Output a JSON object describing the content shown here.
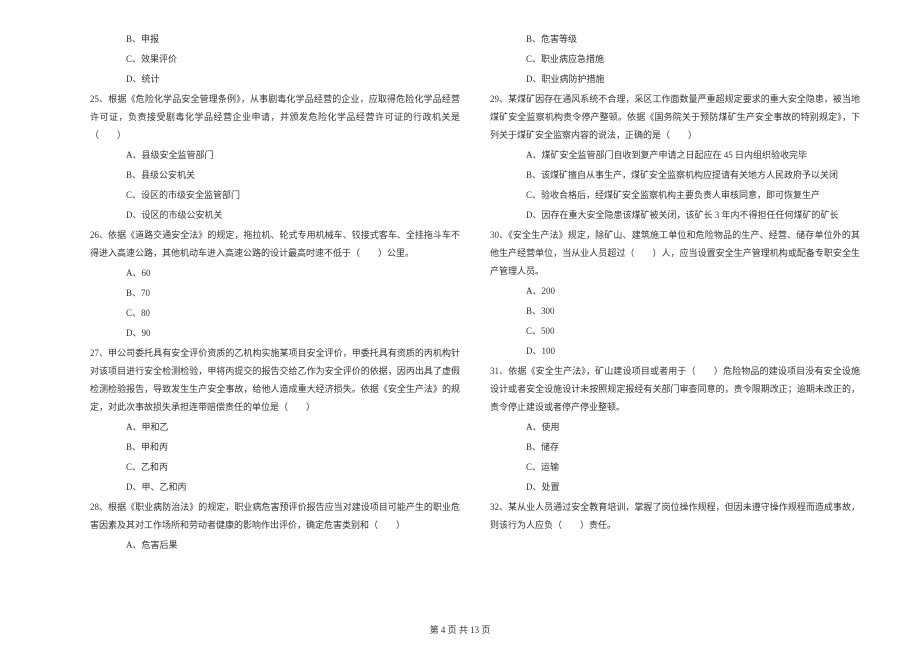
{
  "left_column": {
    "options_24": {
      "b": "B、申报",
      "c": "C、效果评价",
      "d": "D、统计"
    },
    "q25": {
      "text": "25、根据《危险化学品安全管理条例》，从事剧毒化学品经营的企业，应取得危险化学品经营许可证，负责接受剧毒化学品经营企业申请，并颁发危险化学品经营许可证的行政机关是（　　）",
      "a": "A、县级安全监管部门",
      "b": "B、县级公安机关",
      "c": "C、设区的市级安全监管部门",
      "d": "D、设区的市级公安机关"
    },
    "q26": {
      "text": "26、依据《道路交通安全法》的规定，拖拉机、轮式专用机械车、铰接式客车、全挂拖斗车不得进入高速公路，其他机动车进入高速公路的设计最高时速不低于（　　）公里。",
      "a": "A、60",
      "b": "B、70",
      "c": "C、80",
      "d": "D、90"
    },
    "q27": {
      "text": "27、甲公司委托具有安全评价资质的乙机构实施某项目安全评价，甲委托具有资质的丙机构针对该项目进行安全检测检验，甲将丙提交的报告交给乙作为安全评价的依据，因丙出具了虚假检测检验报告，导致发生生产安全事故，给他人造成重大经济损失。依据《安全生产法》的规定，对此次事故损失承担连带赔偿责任的单位是（　　）",
      "a": "A、甲和乙",
      "b": "B、甲和丙",
      "c": "C、乙和丙",
      "d": "D、甲、乙和丙"
    },
    "q28": {
      "text": "28、根据《职业病防治法》的规定，职业病危害预评价报告应当对建设项目可能产生的职业危害因素及其对工作场所和劳动者健康的影响作出评价，确定危害类别和（　　）",
      "a": "A、危害后果"
    }
  },
  "right_column": {
    "options_28": {
      "b": "B、危害等级",
      "c": "C、职业病应急措施",
      "d": "D、职业病防护措施"
    },
    "q29": {
      "text": "29、某煤矿因存在通风系统不合理，采区工作面数量严重超规定要求的重大安全隐患，被当地煤矿安全监察机构责令停产整顿。依据《国务院关于预防煤矿生产安全事故的特别规定》，下列关于煤矿安全监察内容的说法，正确的是（　　）",
      "a": "A、煤矿安全监管部门自收到复产申请之日起应在 45 日内组织验收完毕",
      "b": "B、该煤矿擅自从事生产，煤矿安全监察机构应提请有关地方人民政府予以关闭",
      "c": "C、验收合格后，经煤矿安全监察机构主要负责人审核同意，即可恢复生产",
      "d": "D、因存在重大安全隐患该煤矿被关闭，该矿长 3 年内不得担任任何煤矿的矿长"
    },
    "q30": {
      "text": "30、《安全生产法》规定，除矿山、建筑施工单位和危险物品的生产、经营、储存单位外的其他生产经营单位，当从业人员超过（　　）人，应当设置安全生产管理机构或配备专职安全生产管理人员。",
      "a": "A、200",
      "b": "B、300",
      "c": "C、500",
      "d": "D、100"
    },
    "q31": {
      "text": "31、依据《安全生产法》，矿山建设项目或者用于（　　）危险物品的建设项目没有安全设施设计或者安全设施设计未按照规定报经有关部门审查同意的，责令限期改正；逾期未改正的，责令停止建设或者停产停业整顿。",
      "a": "A、使用",
      "b": "B、储存",
      "c": "C、运输",
      "d": "D、处置"
    },
    "q32": {
      "text": "32、某从业人员通过安全教育培训，掌握了岗位操作规程，但因未遵守操作规程而造成事故，则该行为人应负（　　）责任。"
    }
  },
  "footer": "第 4 页 共 13 页"
}
